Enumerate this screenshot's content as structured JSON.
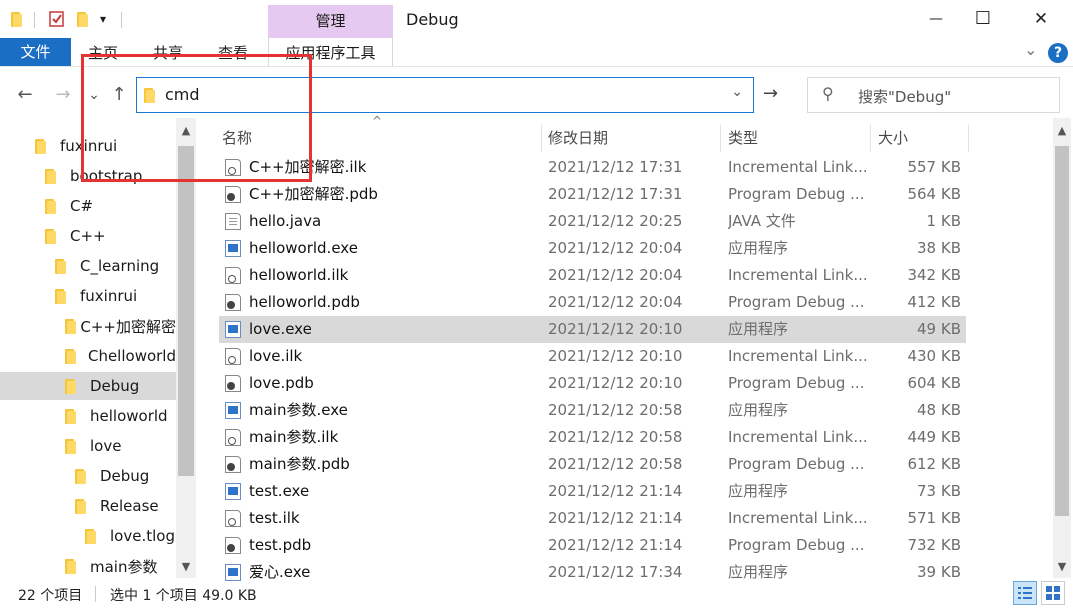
{
  "window": {
    "title": "Debug",
    "manage_tab": "管理",
    "app_tools_tab": "应用程序工具",
    "minimize": "—",
    "maximize": "☐",
    "close": "✕",
    "qa_dropdown": "▾",
    "help": "?",
    "ribbon_toggle": "⌄"
  },
  "ribbon": {
    "tabs": [
      "文件",
      "主页",
      "共享",
      "查看"
    ]
  },
  "nav": {
    "back": "←",
    "forward": "→",
    "recent": "⌄",
    "up": "↑",
    "address_value": "cmd",
    "address_dropdown": "⌄",
    "go": "→",
    "search_placeholder": "搜索\"Debug\"",
    "search_icon": "⚲"
  },
  "tree": {
    "items": [
      {
        "label": "fuxinrui",
        "indent": 0
      },
      {
        "label": "bootstrap",
        "indent": 1
      },
      {
        "label": "C#",
        "indent": 1
      },
      {
        "label": "C++",
        "indent": 1
      },
      {
        "label": "C_learning",
        "indent": 2
      },
      {
        "label": "fuxinrui",
        "indent": 2
      },
      {
        "label": "C++加密解密",
        "indent": 3
      },
      {
        "label": "Chelloworld",
        "indent": 3
      },
      {
        "label": "Debug",
        "indent": 3,
        "selected": true
      },
      {
        "label": "helloworld",
        "indent": 3
      },
      {
        "label": "love",
        "indent": 3
      },
      {
        "label": "Debug",
        "indent": 4
      },
      {
        "label": "Release",
        "indent": 4
      },
      {
        "label": "love.tlog",
        "indent": 5
      },
      {
        "label": "main参数",
        "indent": 3
      }
    ]
  },
  "columns": {
    "name": "名称",
    "date": "修改日期",
    "type": "类型",
    "size": "大小",
    "sort_indicator": "^"
  },
  "files": [
    {
      "name": "C++加密解密.ilk",
      "date": "2021/12/12 17:31",
      "type": "Incremental Link...",
      "size": "557 KB",
      "icon": "ilk"
    },
    {
      "name": "C++加密解密.pdb",
      "date": "2021/12/12 17:31",
      "type": "Program Debug ...",
      "size": "564 KB",
      "icon": "pdb"
    },
    {
      "name": "hello.java",
      "date": "2021/12/12 20:25",
      "type": "JAVA 文件",
      "size": "1 KB",
      "icon": "doc"
    },
    {
      "name": "helloworld.exe",
      "date": "2021/12/12 20:04",
      "type": "应用程序",
      "size": "38 KB",
      "icon": "exe"
    },
    {
      "name": "helloworld.ilk",
      "date": "2021/12/12 20:04",
      "type": "Incremental Link...",
      "size": "342 KB",
      "icon": "ilk"
    },
    {
      "name": "helloworld.pdb",
      "date": "2021/12/12 20:04",
      "type": "Program Debug ...",
      "size": "412 KB",
      "icon": "pdb"
    },
    {
      "name": "love.exe",
      "date": "2021/12/12 20:10",
      "type": "应用程序",
      "size": "49 KB",
      "icon": "exe",
      "selected": true
    },
    {
      "name": "love.ilk",
      "date": "2021/12/12 20:10",
      "type": "Incremental Link...",
      "size": "430 KB",
      "icon": "ilk"
    },
    {
      "name": "love.pdb",
      "date": "2021/12/12 20:10",
      "type": "Program Debug ...",
      "size": "604 KB",
      "icon": "pdb"
    },
    {
      "name": "main参数.exe",
      "date": "2021/12/12 20:58",
      "type": "应用程序",
      "size": "48 KB",
      "icon": "exe"
    },
    {
      "name": "main参数.ilk",
      "date": "2021/12/12 20:58",
      "type": "Incremental Link...",
      "size": "449 KB",
      "icon": "ilk"
    },
    {
      "name": "main参数.pdb",
      "date": "2021/12/12 20:58",
      "type": "Program Debug ...",
      "size": "612 KB",
      "icon": "pdb"
    },
    {
      "name": "test.exe",
      "date": "2021/12/12 21:14",
      "type": "应用程序",
      "size": "73 KB",
      "icon": "exe"
    },
    {
      "name": "test.ilk",
      "date": "2021/12/12 21:14",
      "type": "Incremental Link...",
      "size": "571 KB",
      "icon": "ilk"
    },
    {
      "name": "test.pdb",
      "date": "2021/12/12 21:14",
      "type": "Program Debug ...",
      "size": "732 KB",
      "icon": "pdb"
    },
    {
      "name": "爱心.exe",
      "date": "2021/12/12 17:34",
      "type": "应用程序",
      "size": "39 KB",
      "icon": "exe"
    }
  ],
  "status": {
    "item_count": "22 个项目",
    "selection": "选中 1 个项目 49.0 KB"
  },
  "colors": {
    "accent": "#1a6ec4",
    "manage_tab": "#e6c9f0",
    "selection": "#d9d9d9",
    "annotation": "#e53333"
  }
}
